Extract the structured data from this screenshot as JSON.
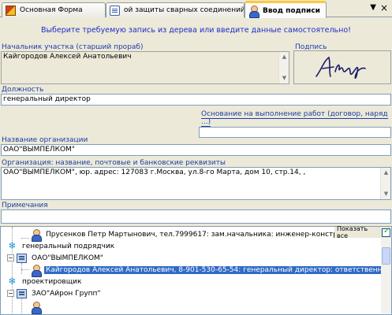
{
  "tabs": [
    {
      "label": "Основная Форма",
      "icon": "form-icon"
    },
    {
      "label": "ой защиты сварных соединений (",
      "icon": "document-icon"
    },
    {
      "label": "Ввод подписи",
      "icon": "person-icon",
      "active": true
    }
  ],
  "tab_controls": {
    "menu": "▼",
    "close": "×"
  },
  "instruction": "Выберите требуемую запись из дерева или введите данные самостоятельно!",
  "fields": {
    "chief_label": "Начальник участка (старший прораб)",
    "chief_value": "Кайгородов Алексей Анатольевич",
    "signature_label": "Подпись",
    "position_label": "Должность",
    "position_value": "генеральный директор",
    "basis_label": "Основание на выполнение работ (договор, наряд ...)",
    "basis_value": "",
    "org_name_label": "Название организации",
    "org_name_value": "ОАО\"ВЫМПЕЛКОМ\"",
    "org_details_label": "Организация: название, почтовые и банковские реквизиты",
    "org_details_value": "ОАО\"ВЫМПЕЛКОМ\", юр. адрес: 127083 г.Москва, ул.8-го Марта, дом 10, стр.14, ,",
    "notes_label": "Примечания",
    "notes_value": ""
  },
  "tree": {
    "show_all_label": "Показать все",
    "show_all_checked": true,
    "nodes": [
      {
        "type": "person",
        "text": "Прусенков Петр Мартынович, тел.7999617:  зам.начальника:  инженер-конструк"
      },
      {
        "type": "category",
        "text": "генеральный подрядчик"
      },
      {
        "type": "org",
        "expander": "−",
        "text": "ОАО\"ВЫМПЕЛКОМ\""
      },
      {
        "type": "person",
        "text": "Кайгородов Алексей Анатольевич, 8-901-530-65-54:  генеральный директор:  ответственный",
        "selected": true
      },
      {
        "type": "category",
        "text": "проектировщик"
      },
      {
        "type": "org",
        "expander": "−",
        "text": "ЗАО\"Айрон Групп\""
      }
    ]
  },
  "colors": {
    "accent": "#1a3fa8",
    "selection": "#316ac5",
    "background": "#ece9d8"
  }
}
